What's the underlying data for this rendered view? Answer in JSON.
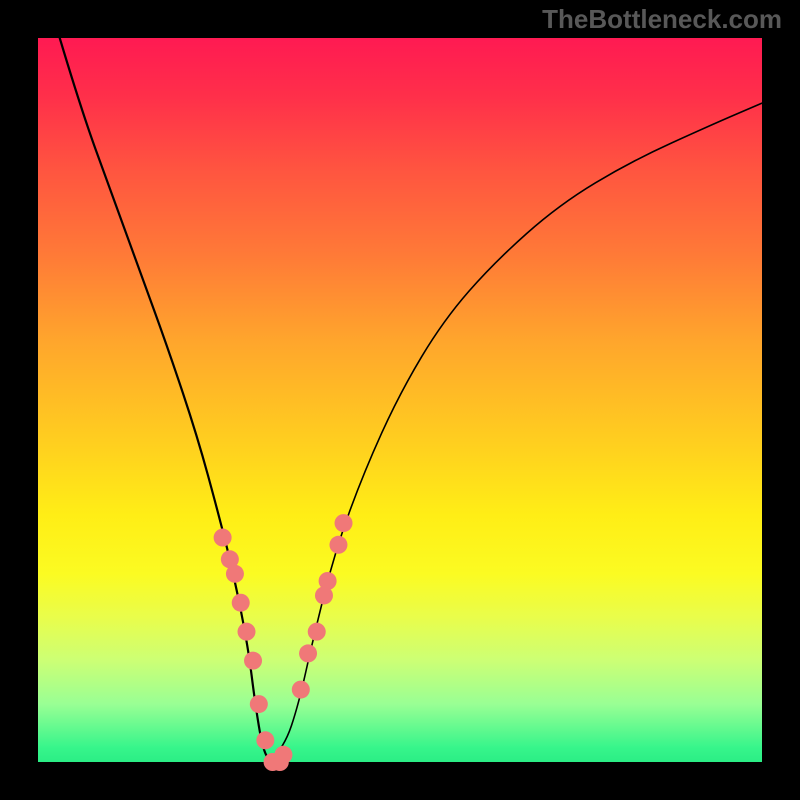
{
  "watermark": "TheBottleneck.com",
  "chart_data": {
    "type": "line",
    "title": "",
    "xlabel": "",
    "ylabel": "",
    "xlim": [
      0,
      100
    ],
    "ylim": [
      0,
      100
    ],
    "grid": false,
    "legend": false,
    "series": [
      {
        "name": "bottleneck-curve",
        "x": [
          3,
          6,
          10,
          14,
          18,
          22,
          25,
          27,
          29,
          30,
          31,
          32,
          34,
          36,
          38,
          41,
          45,
          50,
          56,
          63,
          72,
          82,
          93,
          100
        ],
        "y": [
          100,
          90,
          79,
          68,
          57,
          45,
          34,
          26,
          16,
          8,
          2,
          0,
          2,
          8,
          17,
          29,
          40,
          51,
          61,
          69,
          77,
          83,
          88,
          91
        ]
      }
    ],
    "markers": {
      "name": "highlighted-points",
      "color": "#f07878",
      "x": [
        25.5,
        26.5,
        27.2,
        28.0,
        28.8,
        29.7,
        30.5,
        31.4,
        32.4,
        33.4,
        33.9,
        36.3,
        37.3,
        38.5,
        39.5,
        40.0,
        41.5,
        42.2
      ],
      "y": [
        31,
        28,
        26,
        22,
        18,
        14,
        8,
        3,
        0,
        0,
        1,
        10,
        15,
        18,
        23,
        25,
        30,
        33
      ]
    },
    "background_gradient": {
      "top_color": "#ff1a52",
      "mid_color": "#ffcf1f",
      "bottom_color": "#2bee85"
    }
  }
}
